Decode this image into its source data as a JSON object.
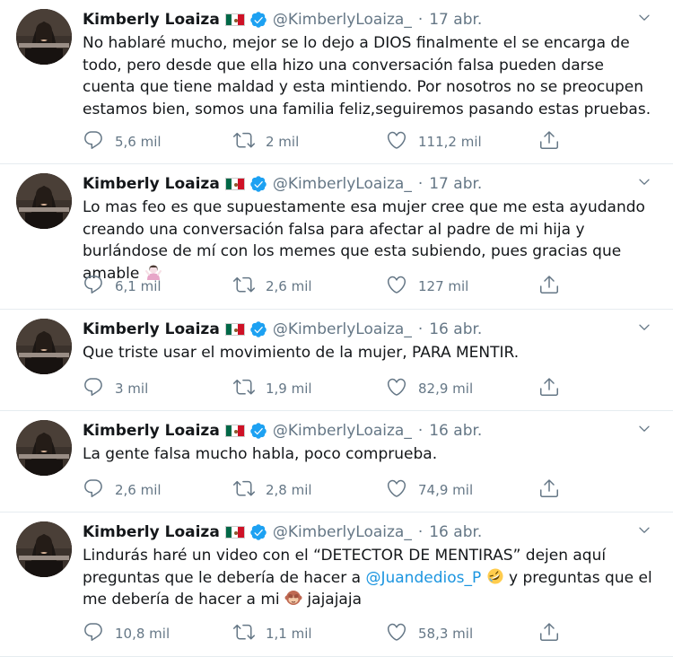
{
  "tweets": [
    {
      "name": "Kimberly Loaiza",
      "handle": "@KimberlyLoaiza_",
      "date": "17 abr.",
      "text": "No hablaré mucho, mejor se lo dejo a DIOS finalmente el se encarga de todo, pero desde que ella hizo una conversación falsa pueden darse cuenta que tiene maldad y esta mintiendo. Por nosotros no se preocupen estamos bien, somos una familia feliz,seguiremos pasando estas pruebas.",
      "replies": "5,6 mil",
      "retweets": "2 mil",
      "likes": "111,2 mil"
    },
    {
      "name": "Kimberly Loaiza",
      "handle": "@KimberlyLoaiza_",
      "date": "17 abr.",
      "text": "Lo mas feo es que supuestamente esa mujer cree que me esta ayudando creando una conversación falsa para afectar al padre de mi hija y burlándose de mí con los memes que esta subiendo, pues gracias que amable",
      "emoji": "woman-shrugging-emoji",
      "replies": "6,1 mil",
      "retweets": "2,6 mil",
      "likes": "127 mil"
    },
    {
      "name": "Kimberly Loaiza",
      "handle": "@KimberlyLoaiza_",
      "date": "16 abr.",
      "text": "Que triste usar el movimiento de la mujer, PARA MENTIR.",
      "replies": "3 mil",
      "retweets": "1,9 mil",
      "likes": "82,9 mil"
    },
    {
      "name": "Kimberly Loaiza",
      "handle": "@KimberlyLoaiza_",
      "date": "16 abr.",
      "text": "La gente falsa mucho habla, poco comprueba.",
      "replies": "2,6 mil",
      "retweets": "2,8 mil",
      "likes": "74,9 mil"
    },
    {
      "name": "Kimberly Loaiza",
      "handle": "@KimberlyLoaiza_",
      "date": "16 abr.",
      "text_before": "Lindurás haré un video con el “DETECTOR DE MENTIRAS” dejen aquí preguntas que le debería de hacer a",
      "mention": "@Juandedios_P",
      "text_middle": "y preguntas que el me debería de hacer a mi",
      "text_after": "jajajaja",
      "emoji_1": "rolling-on-floor-laughing-emoji",
      "emoji_2": "see-no-evil-monkey-emoji",
      "replies": "10,8 mil",
      "retweets": "1,1 mil",
      "likes": "58,3 mil"
    }
  ],
  "colors": {
    "text": "#14171a",
    "secondary": "#657786",
    "link": "#1b95e0",
    "verified": "#1da1f2",
    "divider": "#e6ecf0"
  },
  "icons": {
    "reply": "reply-icon",
    "retweet": "retweet-icon",
    "like": "heart-icon",
    "share": "share-icon",
    "more": "chevron-down-icon",
    "verified": "verified-badge-icon",
    "flag": "mexico-flag-icon"
  }
}
